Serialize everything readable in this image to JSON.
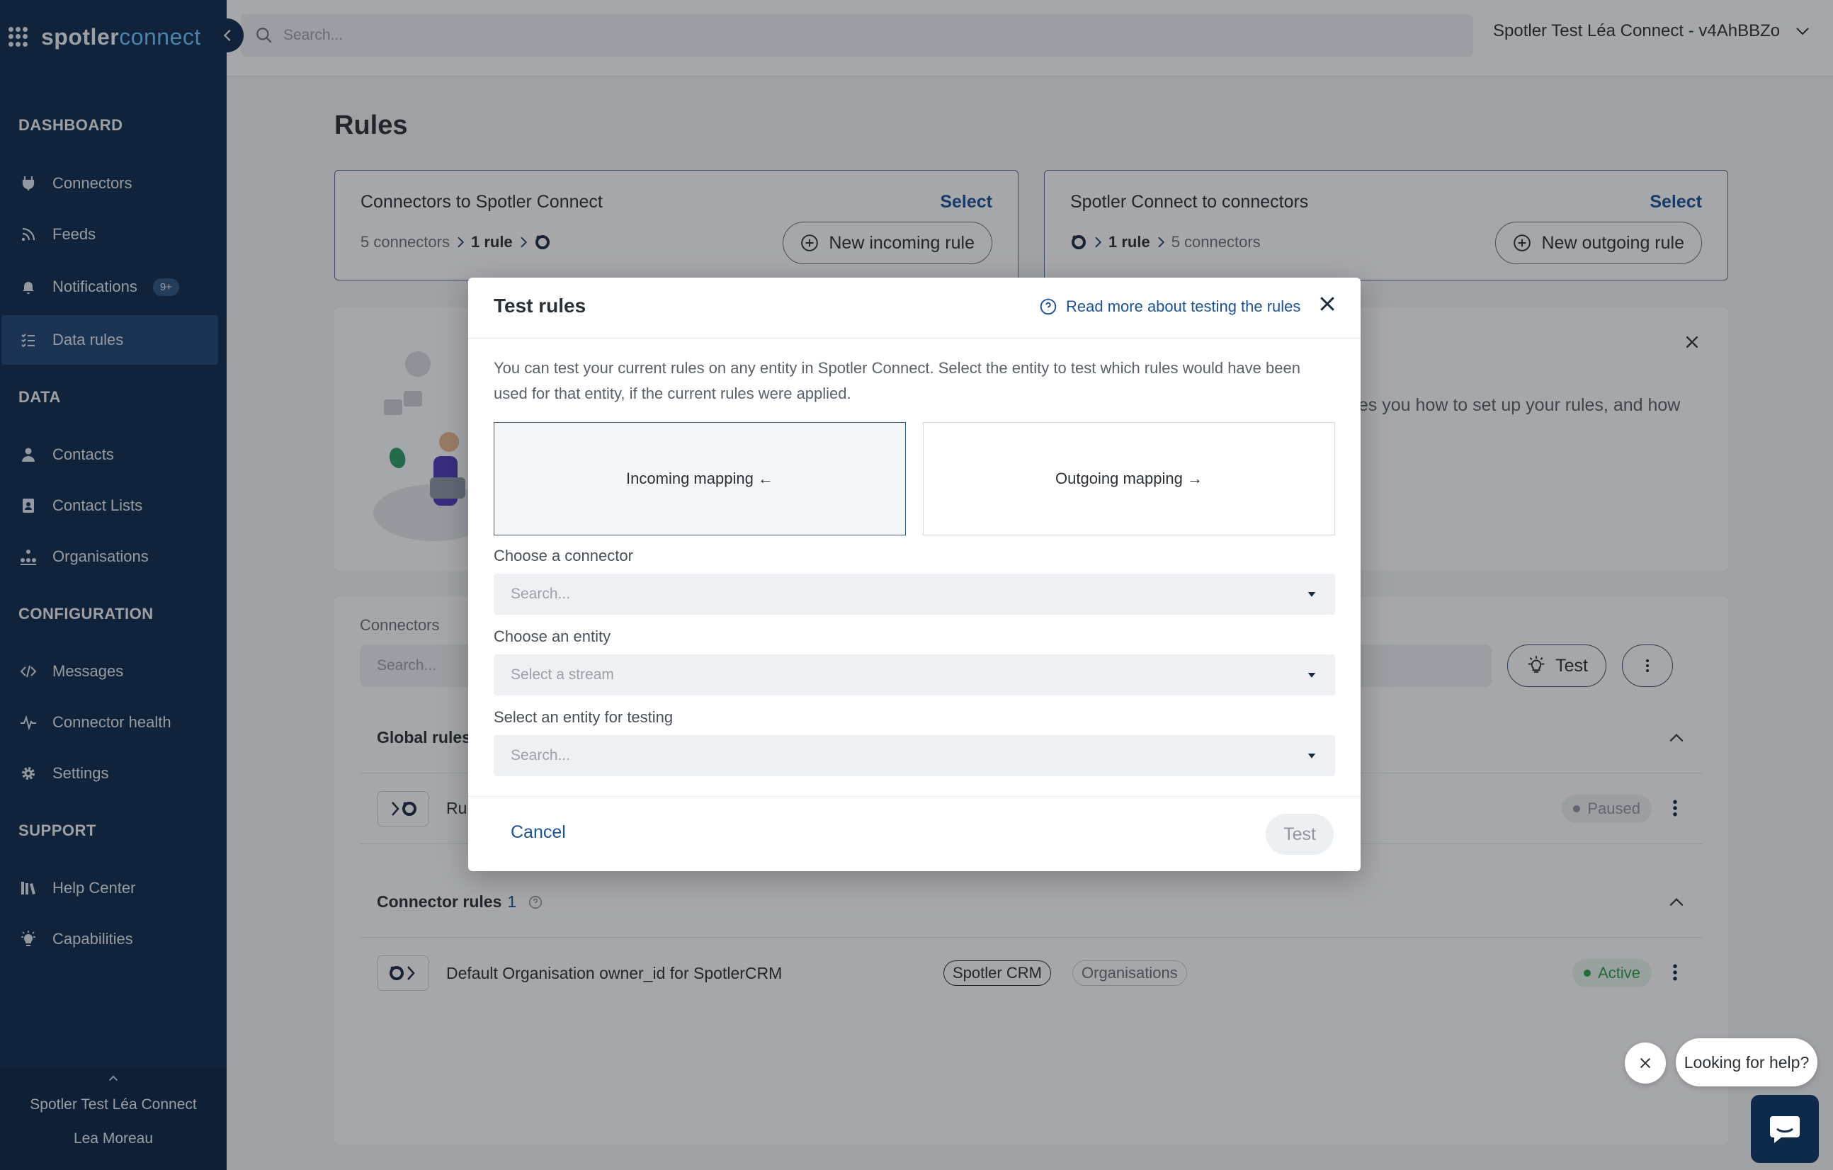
{
  "brand": {
    "name_main": "spotler",
    "name_accent": "connect"
  },
  "topbar": {
    "search_placeholder": "Search...",
    "account": "Spotler Test Léa Connect - v4AhBBZo"
  },
  "sidebar": {
    "sections": [
      "DASHBOARD",
      "DATA",
      "CONFIGURATION",
      "SUPPORT"
    ],
    "items": [
      {
        "label": "Connectors",
        "icon": "plug-icon"
      },
      {
        "label": "Feeds",
        "icon": "rss-icon"
      },
      {
        "label": "Notifications",
        "icon": "bell-icon",
        "badge": "9+"
      },
      {
        "label": "Data rules",
        "icon": "list-icon",
        "active": true
      },
      {
        "label": "Contacts",
        "icon": "user-icon"
      },
      {
        "label": "Contact Lists",
        "icon": "contact-list-icon"
      },
      {
        "label": "Organisations",
        "icon": "organisation-icon"
      },
      {
        "label": "Messages",
        "icon": "code-icon"
      },
      {
        "label": "Connector health",
        "icon": "pulse-icon"
      },
      {
        "label": "Settings",
        "icon": "gear-icon"
      },
      {
        "label": "Help Center",
        "icon": "books-icon"
      },
      {
        "label": "Capabilities",
        "icon": "lightbulb-icon"
      }
    ],
    "footer": {
      "org": "Spotler Test Léa Connect",
      "user": "Lea Moreau"
    }
  },
  "page": {
    "title": "Rules",
    "incoming_card": {
      "title": "Connectors to Spotler Connect",
      "select": "Select",
      "flow_connectors": "5 connectors",
      "flow_rule": "1 rule",
      "button": "New incoming rule"
    },
    "outgoing_card": {
      "title": "Spotler Connect to connectors",
      "select": "Select",
      "flow_rule": "1 rule",
      "flow_connectors": "5 connectors",
      "button": "New outgoing rule"
    },
    "info_text": "hes you how to set up your rules, and how",
    "list": {
      "label": "Connectors",
      "search_placeholder": "Search...",
      "test_button": "Test",
      "global_rules": {
        "title": "Global rules"
      },
      "global_row": {
        "name": "Rul",
        "status": "Paused"
      },
      "connector_rules": {
        "title": "Connector rules",
        "count": "1"
      },
      "connector_row": {
        "name": "Default Organisation owner_id for SpotlerCRM",
        "tag1": "Spotler CRM",
        "tag2": "Organisations",
        "status": "Active"
      }
    }
  },
  "modal": {
    "title": "Test rules",
    "help_link": "Read more about testing the rules",
    "description": "You can test your current rules on any entity in Spotler Connect. Select the entity to test which rules would have been used for that entity, if the current rules were applied.",
    "incoming_option": "Incoming mapping ←",
    "outgoing_option": "Outgoing mapping →",
    "connector_label": "Choose a connector",
    "connector_placeholder": "Search...",
    "entity_label": "Choose an entity",
    "entity_placeholder": "Select a stream",
    "testing_label": "Select an entity for testing",
    "testing_placeholder": "Search...",
    "cancel": "Cancel",
    "test": "Test"
  },
  "help_widget": {
    "bubble": "Looking for help?"
  },
  "colors": {
    "sidebar": "#0e2a4b",
    "accent": "#1c5296",
    "active_green": "#2e9d4f",
    "paused_gray": "#8f96a0"
  }
}
